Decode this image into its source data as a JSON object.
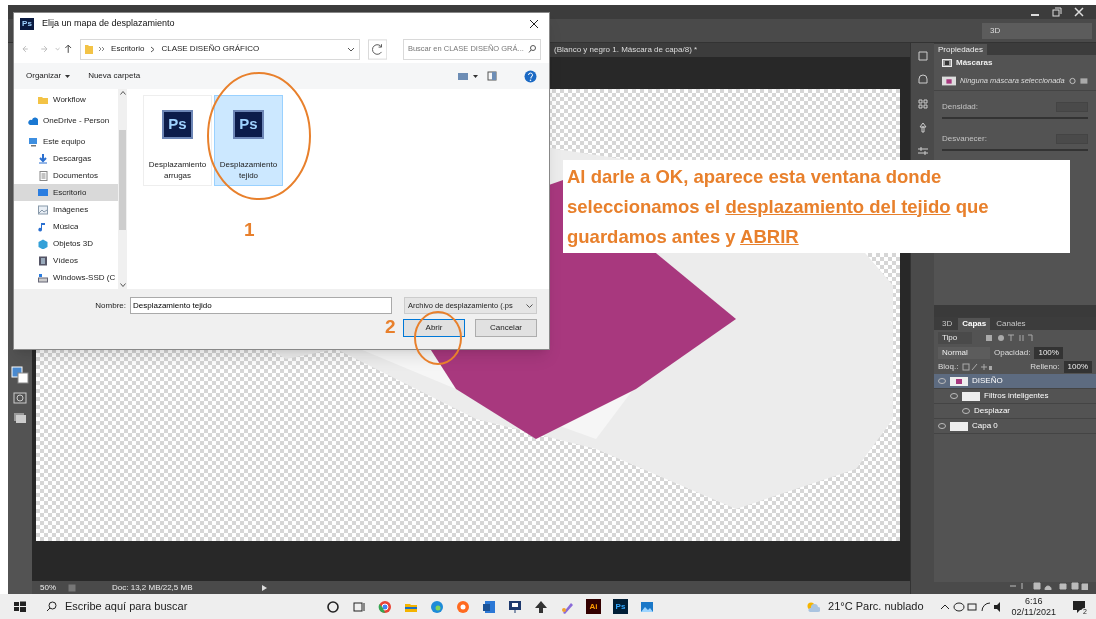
{
  "app": {
    "workspace": "3D",
    "document_tab": "(Blanco y negro 1. Máscara de capa/8) *",
    "status": {
      "zoom": "50%",
      "doc": "Doc: 13,2 MB/22,5 MB"
    }
  },
  "properties_panel": {
    "title": "Propiedades",
    "section": "Máscaras",
    "mask_text": "Ninguna máscara seleccionada",
    "fields": [
      {
        "label": "Densidad:"
      },
      {
        "label": "Desvanecer:"
      }
    ]
  },
  "layers_panel": {
    "tabs": [
      {
        "label": "3D",
        "selected": false
      },
      {
        "label": "Capas",
        "selected": true
      },
      {
        "label": "Canales",
        "selected": false
      }
    ],
    "filter": "Tipo",
    "blend_mode": "Normal",
    "opacity_label": "Opacidad:",
    "opacity": "100%",
    "lock_label": "Bloq.:",
    "fill_label": "Relleno:",
    "fill": "100%",
    "layers": [
      {
        "name": "DISEÑO",
        "selected": true,
        "children": [
          {
            "name": "Filtros inteligentes",
            "selected": false,
            "children": [
              {
                "name": "Desplazar",
                "selected": false
              }
            ]
          }
        ]
      },
      {
        "name": "Capa 0",
        "selected": false
      }
    ]
  },
  "dialog": {
    "title_icon": "Ps",
    "title": "Elija un mapa de desplazamiento",
    "breadcrumb": [
      "Escritorio",
      "CLASE DISEÑO GRÁFICO"
    ],
    "search_placeholder": "Buscar en CLASE DISEÑO GRÁ...",
    "toolbar": [
      "Organizar",
      "Nueva carpeta"
    ],
    "nav_items": [
      {
        "label": "Workflow",
        "kind": "folder",
        "selected": false
      },
      {
        "label": "OneDrive - Person",
        "kind": "cloud",
        "selected": false
      },
      {
        "label": "Este equipo",
        "kind": "computer",
        "selected": false
      },
      {
        "label": "Descargas",
        "kind": "download",
        "selected": false
      },
      {
        "label": "Documentos",
        "kind": "document",
        "selected": false
      },
      {
        "label": "Escritorio",
        "kind": "desktop",
        "selected": true
      },
      {
        "label": "Imágenes",
        "kind": "image",
        "selected": false
      },
      {
        "label": "Música",
        "kind": "music",
        "selected": false
      },
      {
        "label": "Objetos 3D",
        "kind": "cube",
        "selected": false
      },
      {
        "label": "Vídeos",
        "kind": "film",
        "selected": false
      },
      {
        "label": "Windows-SSD (C",
        "kind": "drive",
        "selected": false
      }
    ],
    "files": [
      {
        "name": "Desplazamiento arrugas",
        "icon_label": "Ps",
        "selected": false
      },
      {
        "name": "Desplazamiento tejido",
        "icon_label": "Ps",
        "selected": true
      }
    ],
    "name_label": "Nombre:",
    "name_value": "Desplazamiento tejido",
    "file_type": "Archivo de desplazamiento (.ps",
    "buttons": [
      "Abrir",
      "Cancelar"
    ]
  },
  "annotation": {
    "segments": [
      {
        "text": "Al darle a OK, aparece esta ventana donde seleccionamos el ",
        "underline": false
      },
      {
        "text": "desplazamiento del tejido",
        "underline": true
      },
      {
        "text": " que guardamos antes y ",
        "underline": false
      },
      {
        "text": "ABRIR",
        "underline": true
      }
    ],
    "markers": [
      "1",
      "2"
    ]
  },
  "taskbar": {
    "search_placeholder": "Escribe aquí para buscar",
    "apps": [
      {
        "kind": "ring"
      },
      {
        "kind": "tiles"
      },
      {
        "kind": "wheel"
      },
      {
        "kind": "folder"
      },
      {
        "kind": "swirl"
      },
      {
        "kind": "dot"
      },
      {
        "kind": "doc"
      },
      {
        "kind": "monitor"
      },
      {
        "kind": "spade"
      },
      {
        "kind": "brush"
      },
      {
        "kind": "tile",
        "label": "Ai"
      },
      {
        "kind": "tile",
        "label": "Ps"
      },
      {
        "kind": "picture"
      }
    ],
    "weather": "21°C Parc. nublado",
    "time": "6:16",
    "date": "02/11/2021",
    "notifications": "2"
  }
}
